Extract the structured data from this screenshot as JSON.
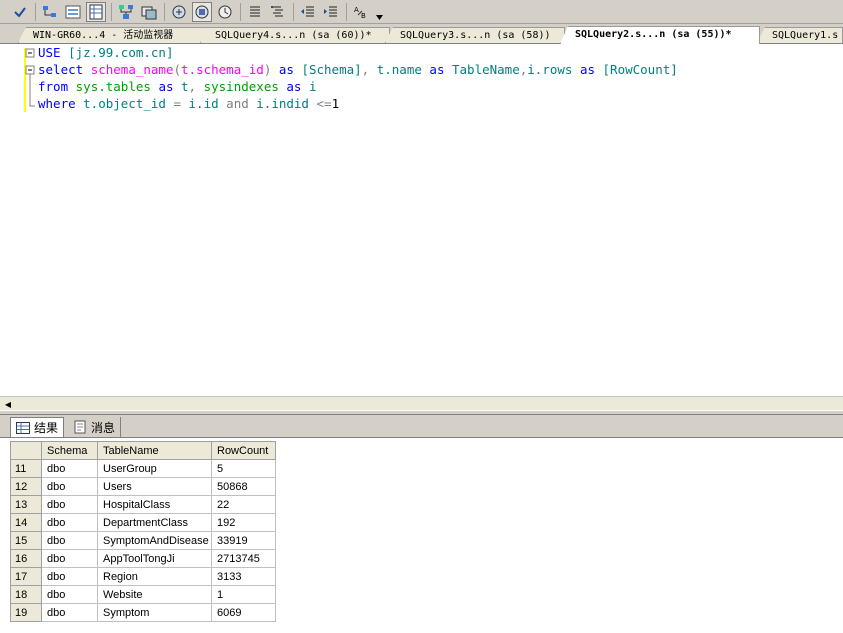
{
  "toolbar": {
    "buttons": [
      "parse-icon",
      "display-plan-icon",
      "query-designer-icon",
      "results-to-text-icon",
      "results-to-grid-icon",
      "results-to-file-icon",
      "include-plan-icon",
      "client-stats-icon",
      "query-options-icon",
      "comment-icon",
      "uncomment-icon",
      "decrease-indent-icon",
      "increase-indent-icon",
      "specify-values-icon"
    ]
  },
  "tabs": [
    {
      "label": "WIN-GR60...4 - 活动监视器"
    },
    {
      "label": "SQLQuery4.s...n (sa (60))*"
    },
    {
      "label": "SQLQuery3.s...n (sa (58))"
    },
    {
      "label": "SQLQuery2.s...n (sa (55))*"
    },
    {
      "label": "SQLQuery1.s"
    }
  ],
  "editor": {
    "lines": [
      [
        {
          "t": "USE ",
          "c": "kw"
        },
        {
          "t": "[jz.99.com.cn]",
          "c": "id"
        }
      ],
      [
        {
          "t": "select ",
          "c": "kw"
        },
        {
          "t": "schema_name",
          "c": "fn"
        },
        {
          "t": "(",
          "c": "gr"
        },
        {
          "t": "t.schema_id",
          "c": "fn"
        },
        {
          "t": ") ",
          "c": "gr"
        },
        {
          "t": "as ",
          "c": "kw"
        },
        {
          "t": "[Schema]",
          "c": "id"
        },
        {
          "t": ", ",
          "c": "gr"
        },
        {
          "t": "t.name ",
          "c": "id"
        },
        {
          "t": "as ",
          "c": "kw"
        },
        {
          "t": "TableName",
          "c": "id"
        },
        {
          "t": ",",
          "c": "gr"
        },
        {
          "t": "i.rows ",
          "c": "id"
        },
        {
          "t": "as ",
          "c": "kw"
        },
        {
          "t": "[RowCount]",
          "c": "id"
        }
      ],
      [
        {
          "t": "from ",
          "c": "kw"
        },
        {
          "t": "sys.tables ",
          "c": "sys"
        },
        {
          "t": "as ",
          "c": "kw"
        },
        {
          "t": "t",
          "c": "id"
        },
        {
          "t": ", ",
          "c": "gr"
        },
        {
          "t": "sysindexes ",
          "c": "sys"
        },
        {
          "t": "as ",
          "c": "kw"
        },
        {
          "t": "i",
          "c": "id"
        }
      ],
      [
        {
          "t": "where ",
          "c": "kw"
        },
        {
          "t": "t.object_id ",
          "c": "id"
        },
        {
          "t": "= ",
          "c": "gr"
        },
        {
          "t": "i.id ",
          "c": "id"
        },
        {
          "t": "and ",
          "c": "gr"
        },
        {
          "t": "i.indid ",
          "c": "id"
        },
        {
          "t": "<=",
          "c": "gr"
        },
        {
          "t": "1",
          "c": ""
        }
      ]
    ]
  },
  "results": {
    "tab_results": "结果",
    "tab_messages": "消息",
    "columns": [
      "Schema",
      "TableName",
      "RowCount"
    ],
    "rows": [
      {
        "n": "11",
        "schema": "dbo",
        "table": "UserGroup",
        "count": "5"
      },
      {
        "n": "12",
        "schema": "dbo",
        "table": "Users",
        "count": "50868"
      },
      {
        "n": "13",
        "schema": "dbo",
        "table": "HospitalClass",
        "count": "22"
      },
      {
        "n": "14",
        "schema": "dbo",
        "table": "DepartmentClass",
        "count": "192"
      },
      {
        "n": "15",
        "schema": "dbo",
        "table": "SymptomAndDisease",
        "count": "33919"
      },
      {
        "n": "16",
        "schema": "dbo",
        "table": "AppToolTongJi",
        "count": "2713745"
      },
      {
        "n": "17",
        "schema": "dbo",
        "table": "Region",
        "count": "3133"
      },
      {
        "n": "18",
        "schema": "dbo",
        "table": "Website",
        "count": "1"
      },
      {
        "n": "19",
        "schema": "dbo",
        "table": "Symptom",
        "count": "6069"
      }
    ]
  }
}
